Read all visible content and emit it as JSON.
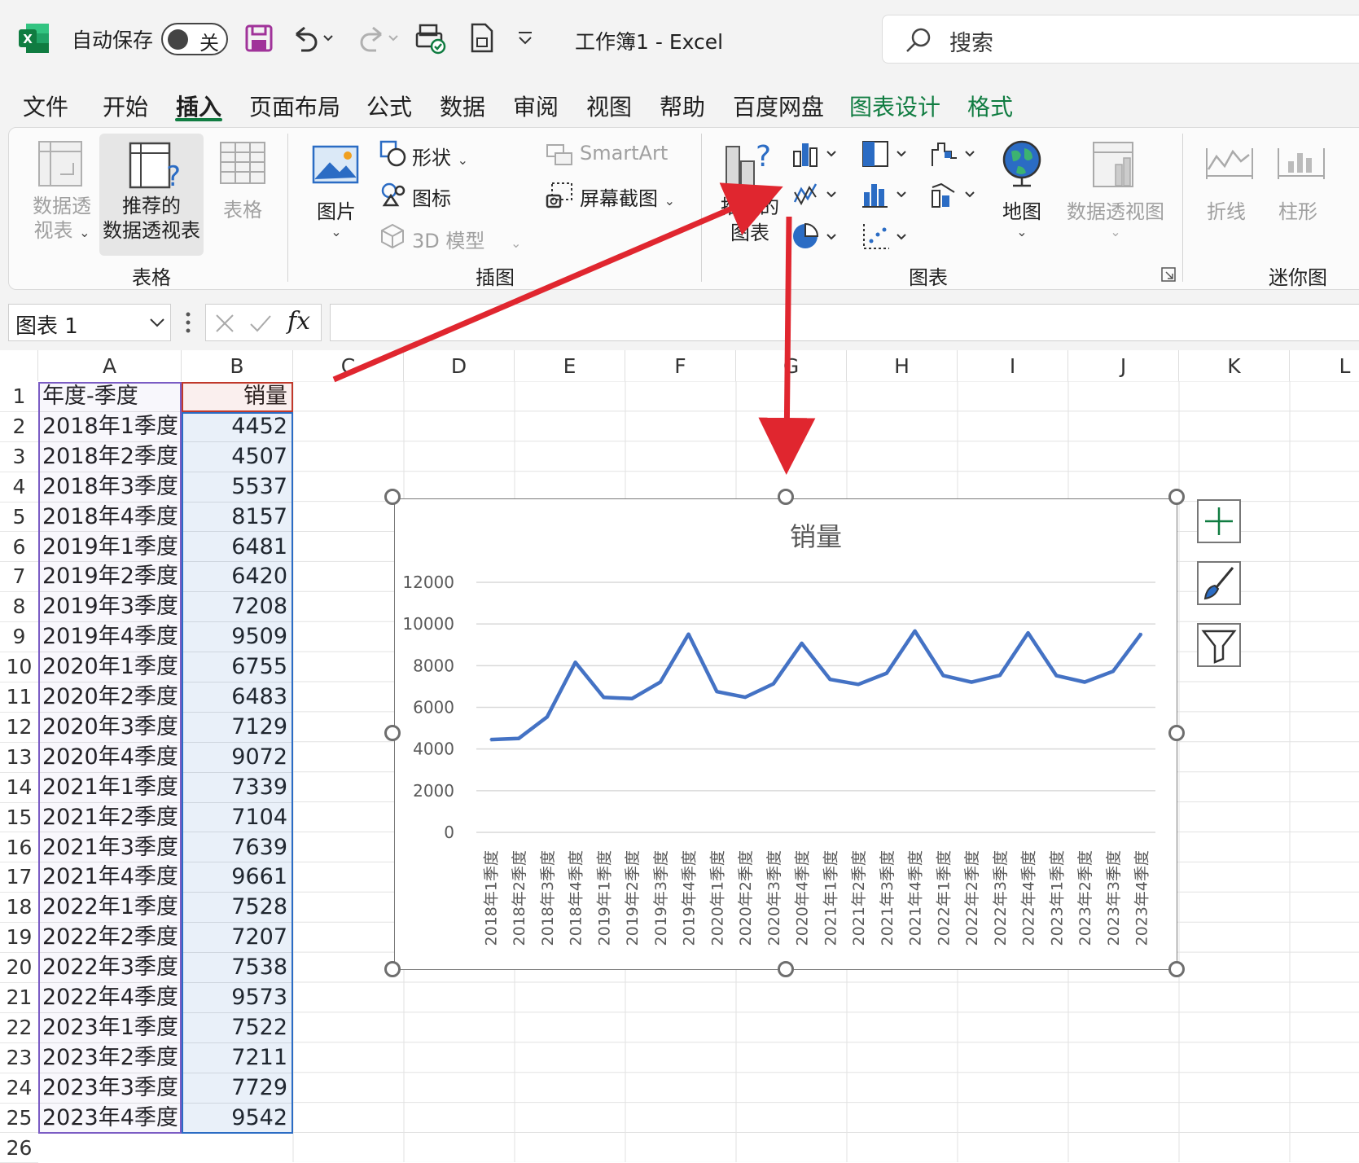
{
  "titlebar": {
    "autosave_label": "自动保存",
    "autosave_state": "关",
    "doc_title": "工作簿1  -  Excel",
    "search_placeholder": "搜索"
  },
  "menu": {
    "tabs": [
      "文件",
      "开始",
      "插入",
      "页面布局",
      "公式",
      "数据",
      "审阅",
      "视图",
      "帮助",
      "百度网盘",
      "图表设计",
      "格式"
    ],
    "active": "插入"
  },
  "ribbon": {
    "table_group": {
      "label": "表格",
      "pivot_table": [
        "数据透",
        "视表"
      ],
      "recommended_pivot": [
        "推荐的",
        "数据透视表"
      ],
      "table": "表格"
    },
    "illustrations_group": {
      "label": "插图",
      "picture": "图片",
      "shapes": "形状",
      "icons": "图标",
      "model_3d": "3D 模型",
      "smartart": "SmartArt",
      "screenshot": "屏幕截图"
    },
    "charts_group": {
      "label": "图表",
      "recommended_charts": [
        "推荐的",
        "图表"
      ],
      "maps": "地图",
      "pivot_chart": "数据透视图"
    },
    "sparklines_group": {
      "label": "迷你图",
      "line": "折线",
      "column": "柱形"
    }
  },
  "formula_bar": {
    "name_box": "图表 1",
    "fx": "fx",
    "formula": ""
  },
  "columns": [
    "A",
    "B",
    "C",
    "D",
    "E",
    "F",
    "G",
    "H",
    "I",
    "J",
    "K",
    "L"
  ],
  "sheet": {
    "header": [
      "年度-季度",
      "销量"
    ],
    "rows": [
      [
        "2018年1季度",
        "4452"
      ],
      [
        "2018年2季度",
        "4507"
      ],
      [
        "2018年3季度",
        "5537"
      ],
      [
        "2018年4季度",
        "8157"
      ],
      [
        "2019年1季度",
        "6481"
      ],
      [
        "2019年2季度",
        "6420"
      ],
      [
        "2019年3季度",
        "7208"
      ],
      [
        "2019年4季度",
        "9509"
      ],
      [
        "2020年1季度",
        "6755"
      ],
      [
        "2020年2季度",
        "6483"
      ],
      [
        "2020年3季度",
        "7129"
      ],
      [
        "2020年4季度",
        "9072"
      ],
      [
        "2021年1季度",
        "7339"
      ],
      [
        "2021年2季度",
        "7104"
      ],
      [
        "2021年3季度",
        "7639"
      ],
      [
        "2021年4季度",
        "9661"
      ],
      [
        "2022年1季度",
        "7528"
      ],
      [
        "2022年2季度",
        "7207"
      ],
      [
        "2022年3季度",
        "7538"
      ],
      [
        "2022年4季度",
        "9573"
      ],
      [
        "2023年1季度",
        "7522"
      ],
      [
        "2023年2季度",
        "7211"
      ],
      [
        "2023年3季度",
        "7729"
      ],
      [
        "2023年4季度",
        "9542"
      ]
    ],
    "row_numbers": [
      "1",
      "2",
      "3",
      "4",
      "5",
      "6",
      "7",
      "8",
      "9",
      "10",
      "11",
      "12",
      "13",
      "14",
      "15",
      "16",
      "17",
      "18",
      "19",
      "20",
      "21",
      "22",
      "23",
      "24",
      "25",
      "26"
    ]
  },
  "chart_data": {
    "type": "line",
    "title": "销量",
    "categories": [
      "2018年1季度",
      "2018年2季度",
      "2018年3季度",
      "2018年4季度",
      "2019年1季度",
      "2019年2季度",
      "2019年3季度",
      "2019年4季度",
      "2020年1季度",
      "2020年2季度",
      "2020年3季度",
      "2020年4季度",
      "2021年1季度",
      "2021年2季度",
      "2021年3季度",
      "2021年4季度",
      "2022年1季度",
      "2022年2季度",
      "2022年3季度",
      "2022年4季度",
      "2023年1季度",
      "2023年2季度",
      "2023年3季度",
      "2023年4季度"
    ],
    "series": [
      {
        "values": [
          4452,
          4507,
          5537,
          8157,
          6481,
          6420,
          7208,
          9509,
          6755,
          6483,
          7129,
          9072,
          7339,
          7104,
          7639,
          9661,
          7528,
          7207,
          7538,
          9573,
          7522,
          7211,
          7729,
          9542
        ]
      }
    ],
    "ylim": [
      0,
      12000
    ],
    "yticks": [
      0,
      2000,
      4000,
      6000,
      8000,
      10000,
      12000
    ],
    "grid": true,
    "line_color": "#4472c4",
    "legend": "none"
  },
  "colors": {
    "excel_green": "#107c41",
    "annotation_arrow": "#e0262f",
    "series_blue": "#4472c4"
  }
}
